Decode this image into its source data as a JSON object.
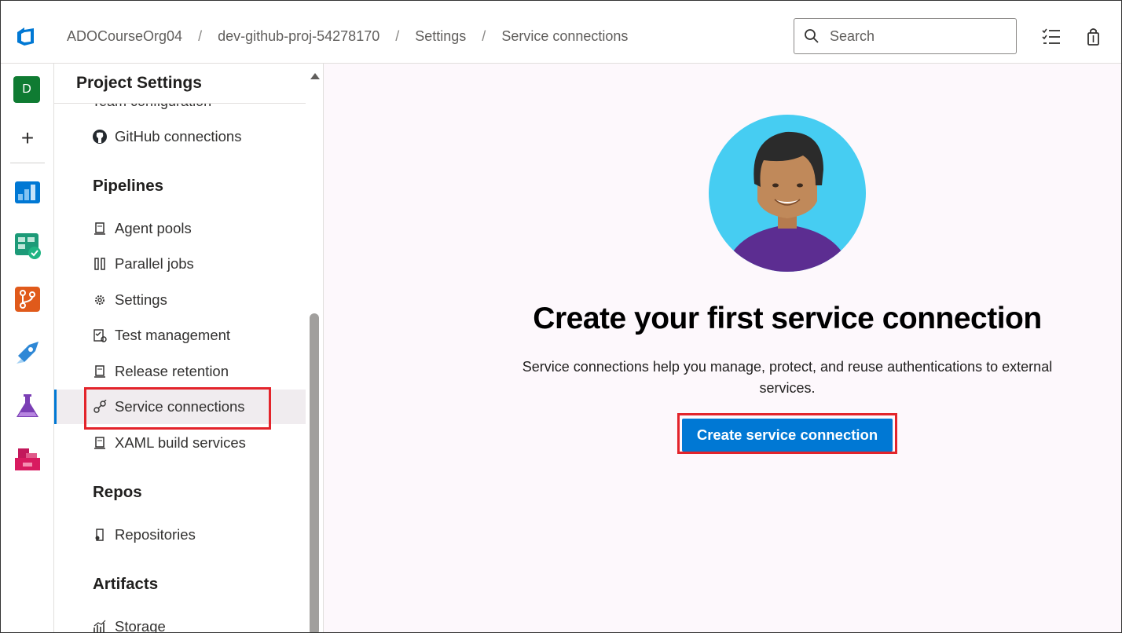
{
  "header": {
    "breadcrumb": [
      "ADOCourseOrg04",
      "dev-github-proj-54278170",
      "Settings",
      "Service connections"
    ],
    "separator": "/",
    "search_placeholder": "Search"
  },
  "rail": {
    "avatar_letter": "D",
    "add_label": "+"
  },
  "sidebar": {
    "title": "Project Settings",
    "clipped_item": "Team configuration",
    "github_connections": "GitHub connections",
    "groups": {
      "pipelines": "Pipelines",
      "repos": "Repos",
      "artifacts": "Artifacts"
    },
    "pipelines_items": [
      "Agent pools",
      "Parallel jobs",
      "Settings",
      "Test management",
      "Release retention",
      "Service connections",
      "XAML build services"
    ],
    "repos_items": [
      "Repositories"
    ],
    "artifacts_items": [
      "Storage"
    ],
    "selected": "Service connections"
  },
  "main": {
    "title": "Create your first service connection",
    "description": "Service connections help you manage, protect, and reuse authentications to external services.",
    "cta_label": "Create service connection"
  },
  "colors": {
    "accent": "#0078d4",
    "highlight": "#e3242b",
    "hero_bg": "#46cdf2",
    "shirt": "#5c2d91"
  }
}
